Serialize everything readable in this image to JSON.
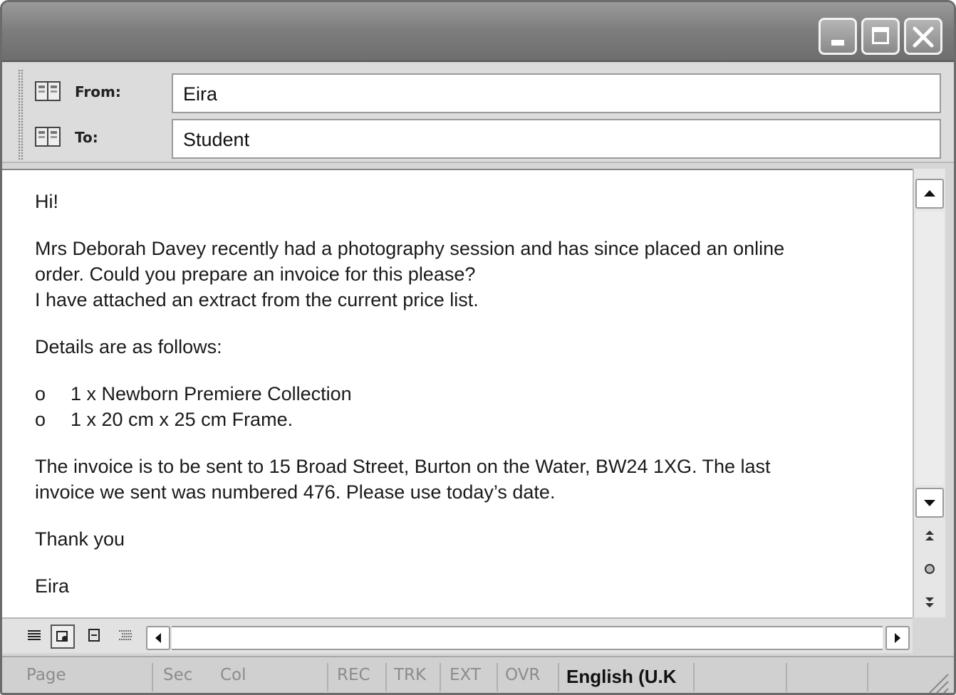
{
  "window_controls": {
    "minimize": "minimize",
    "maximize": "maximize",
    "close": "close"
  },
  "header": {
    "from_label": "From:",
    "from_value": "Eira",
    "to_label": "To:",
    "to_value": "Student"
  },
  "message": {
    "greeting": "Hi!",
    "paragraph1_line1": "Mrs Deborah Davey recently had a photography session and has since placed an online",
    "paragraph1_line2": "order.  Could you prepare an invoice for this please?",
    "paragraph1_line3": "I have attached an extract from the current price list.",
    "details_intro": "Details are as follows:",
    "items": [
      {
        "bullet": "o",
        "text": "1 x Newborn Premiere Collection"
      },
      {
        "bullet": "o",
        "text": "1 x 20 cm x 25 cm Frame."
      }
    ],
    "paragraph2_line1": "The invoice is to be sent to 15 Broad Street, Burton on the Water, BW24 1XG. The last",
    "paragraph2_line2": "invoice we sent was numbered 476. Please use today’s date.",
    "closing": "Thank you",
    "signature": "Eira"
  },
  "statusbar": {
    "page": "Page",
    "sec": "Sec",
    "col": "Col",
    "rec": "REC",
    "trk": "TRK",
    "ext": "EXT",
    "ovr": "OVR",
    "language": "English (U.K"
  },
  "icons": {
    "from_address_book": "address-book-icon",
    "to_address_book": "address-book-icon",
    "scroll_up": "triangle-up-icon",
    "scroll_down": "triangle-down-icon",
    "prev_page": "double-up-arrow-icon",
    "select_browse": "circle-icon",
    "next_page": "double-down-arrow-icon",
    "scroll_left": "triangle-left-icon",
    "scroll_right": "triangle-right-icon"
  }
}
